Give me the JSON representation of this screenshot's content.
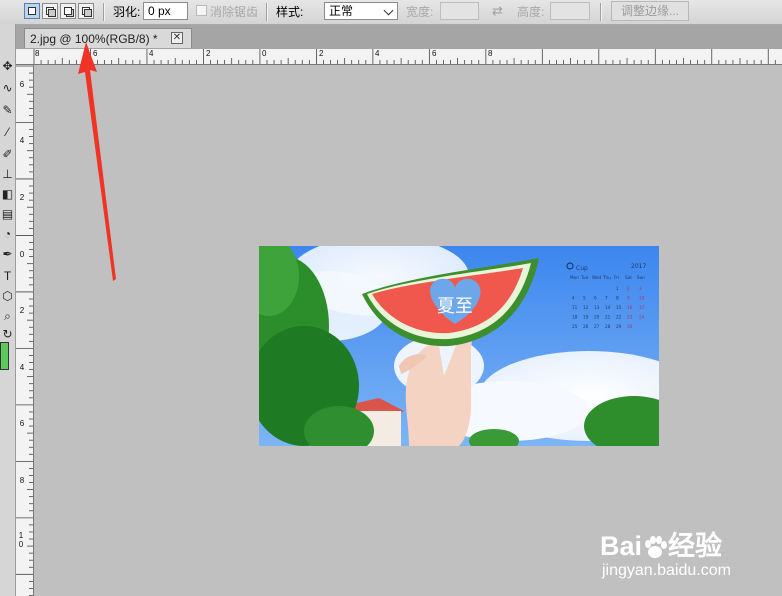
{
  "options_bar": {
    "feather_label": "羽化:",
    "feather_value": "0 px",
    "antialias_label": "消除锯齿",
    "style_label": "样式:",
    "style_value": "正常",
    "width_label": "宽度:",
    "height_label": "高度:",
    "refine_edge_label": "调整边缘..."
  },
  "document_tab": {
    "title": "2.jpg @ 100%(RGB/8) *",
    "close_glyph": "✕"
  },
  "ruler": {
    "horizontal_labels": [
      "8",
      "6",
      "4",
      "2",
      "0",
      "2",
      "4",
      "6",
      "8"
    ],
    "vertical_labels": [
      "6",
      "4",
      "2",
      "0",
      "2",
      "4",
      "6",
      "8",
      "1 0"
    ]
  },
  "toolbox": {
    "tools": [
      "move-icon",
      "lasso-icon",
      "quick-select-icon",
      "brush-icon",
      "stamp-icon",
      "eraser-icon",
      "gradient-icon",
      "pen-icon",
      "type-icon",
      "shape-icon",
      "zoom-icon",
      "rotate-view-icon"
    ],
    "fg_color": "#5cc95c"
  },
  "image": {
    "calendar_month": "Cup",
    "calendar_year": "2017",
    "calendar_weekdays": [
      "Mon",
      "Tue",
      "Wed",
      "Thu",
      "Fri",
      "Sat",
      "Sun"
    ],
    "calendar_rows": [
      [
        "",
        "",
        "",
        "",
        "1",
        "2",
        "3"
      ],
      [
        "4",
        "5",
        "6",
        "7",
        "8",
        "9",
        "10"
      ],
      [
        "11",
        "12",
        "13",
        "14",
        "15",
        "16",
        "17"
      ],
      [
        "18",
        "19",
        "20",
        "21",
        "22",
        "23",
        "24"
      ],
      [
        "25",
        "26",
        "27",
        "28",
        "29",
        "30",
        ""
      ]
    ],
    "heart_text": "夏至"
  },
  "watermark": {
    "logo_text_left": "Bai",
    "logo_text_right": "经验",
    "url": "jingyan.baidu.com"
  },
  "annotation": {
    "arrow_color": "#f03325"
  }
}
